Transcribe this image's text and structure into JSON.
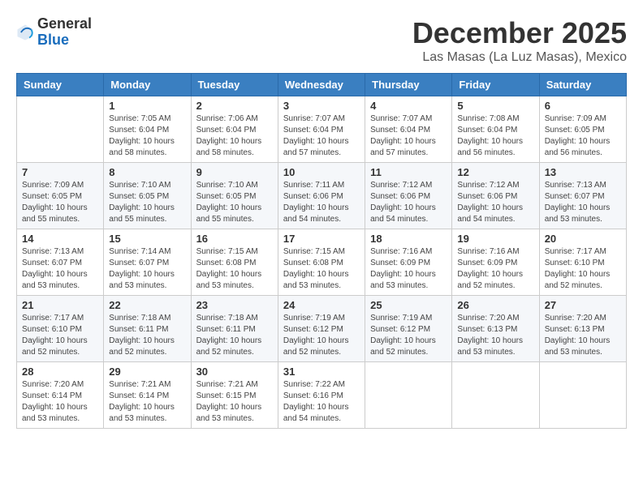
{
  "logo": {
    "general": "General",
    "blue": "Blue"
  },
  "header": {
    "month_title": "December 2025",
    "location": "Las Masas (La Luz Masas), Mexico"
  },
  "weekdays": [
    "Sunday",
    "Monday",
    "Tuesday",
    "Wednesday",
    "Thursday",
    "Friday",
    "Saturday"
  ],
  "weeks": [
    [
      {
        "day": "",
        "info": ""
      },
      {
        "day": "1",
        "info": "Sunrise: 7:05 AM\nSunset: 6:04 PM\nDaylight: 10 hours\nand 58 minutes."
      },
      {
        "day": "2",
        "info": "Sunrise: 7:06 AM\nSunset: 6:04 PM\nDaylight: 10 hours\nand 58 minutes."
      },
      {
        "day": "3",
        "info": "Sunrise: 7:07 AM\nSunset: 6:04 PM\nDaylight: 10 hours\nand 57 minutes."
      },
      {
        "day": "4",
        "info": "Sunrise: 7:07 AM\nSunset: 6:04 PM\nDaylight: 10 hours\nand 57 minutes."
      },
      {
        "day": "5",
        "info": "Sunrise: 7:08 AM\nSunset: 6:04 PM\nDaylight: 10 hours\nand 56 minutes."
      },
      {
        "day": "6",
        "info": "Sunrise: 7:09 AM\nSunset: 6:05 PM\nDaylight: 10 hours\nand 56 minutes."
      }
    ],
    [
      {
        "day": "7",
        "info": "Sunrise: 7:09 AM\nSunset: 6:05 PM\nDaylight: 10 hours\nand 55 minutes."
      },
      {
        "day": "8",
        "info": "Sunrise: 7:10 AM\nSunset: 6:05 PM\nDaylight: 10 hours\nand 55 minutes."
      },
      {
        "day": "9",
        "info": "Sunrise: 7:10 AM\nSunset: 6:05 PM\nDaylight: 10 hours\nand 55 minutes."
      },
      {
        "day": "10",
        "info": "Sunrise: 7:11 AM\nSunset: 6:06 PM\nDaylight: 10 hours\nand 54 minutes."
      },
      {
        "day": "11",
        "info": "Sunrise: 7:12 AM\nSunset: 6:06 PM\nDaylight: 10 hours\nand 54 minutes."
      },
      {
        "day": "12",
        "info": "Sunrise: 7:12 AM\nSunset: 6:06 PM\nDaylight: 10 hours\nand 54 minutes."
      },
      {
        "day": "13",
        "info": "Sunrise: 7:13 AM\nSunset: 6:07 PM\nDaylight: 10 hours\nand 53 minutes."
      }
    ],
    [
      {
        "day": "14",
        "info": "Sunrise: 7:13 AM\nSunset: 6:07 PM\nDaylight: 10 hours\nand 53 minutes."
      },
      {
        "day": "15",
        "info": "Sunrise: 7:14 AM\nSunset: 6:07 PM\nDaylight: 10 hours\nand 53 minutes."
      },
      {
        "day": "16",
        "info": "Sunrise: 7:15 AM\nSunset: 6:08 PM\nDaylight: 10 hours\nand 53 minutes."
      },
      {
        "day": "17",
        "info": "Sunrise: 7:15 AM\nSunset: 6:08 PM\nDaylight: 10 hours\nand 53 minutes."
      },
      {
        "day": "18",
        "info": "Sunrise: 7:16 AM\nSunset: 6:09 PM\nDaylight: 10 hours\nand 53 minutes."
      },
      {
        "day": "19",
        "info": "Sunrise: 7:16 AM\nSunset: 6:09 PM\nDaylight: 10 hours\nand 52 minutes."
      },
      {
        "day": "20",
        "info": "Sunrise: 7:17 AM\nSunset: 6:10 PM\nDaylight: 10 hours\nand 52 minutes."
      }
    ],
    [
      {
        "day": "21",
        "info": "Sunrise: 7:17 AM\nSunset: 6:10 PM\nDaylight: 10 hours\nand 52 minutes."
      },
      {
        "day": "22",
        "info": "Sunrise: 7:18 AM\nSunset: 6:11 PM\nDaylight: 10 hours\nand 52 minutes."
      },
      {
        "day": "23",
        "info": "Sunrise: 7:18 AM\nSunset: 6:11 PM\nDaylight: 10 hours\nand 52 minutes."
      },
      {
        "day": "24",
        "info": "Sunrise: 7:19 AM\nSunset: 6:12 PM\nDaylight: 10 hours\nand 52 minutes."
      },
      {
        "day": "25",
        "info": "Sunrise: 7:19 AM\nSunset: 6:12 PM\nDaylight: 10 hours\nand 52 minutes."
      },
      {
        "day": "26",
        "info": "Sunrise: 7:20 AM\nSunset: 6:13 PM\nDaylight: 10 hours\nand 53 minutes."
      },
      {
        "day": "27",
        "info": "Sunrise: 7:20 AM\nSunset: 6:13 PM\nDaylight: 10 hours\nand 53 minutes."
      }
    ],
    [
      {
        "day": "28",
        "info": "Sunrise: 7:20 AM\nSunset: 6:14 PM\nDaylight: 10 hours\nand 53 minutes."
      },
      {
        "day": "29",
        "info": "Sunrise: 7:21 AM\nSunset: 6:14 PM\nDaylight: 10 hours\nand 53 minutes."
      },
      {
        "day": "30",
        "info": "Sunrise: 7:21 AM\nSunset: 6:15 PM\nDaylight: 10 hours\nand 53 minutes."
      },
      {
        "day": "31",
        "info": "Sunrise: 7:22 AM\nSunset: 6:16 PM\nDaylight: 10 hours\nand 54 minutes."
      },
      {
        "day": "",
        "info": ""
      },
      {
        "day": "",
        "info": ""
      },
      {
        "day": "",
        "info": ""
      }
    ]
  ]
}
